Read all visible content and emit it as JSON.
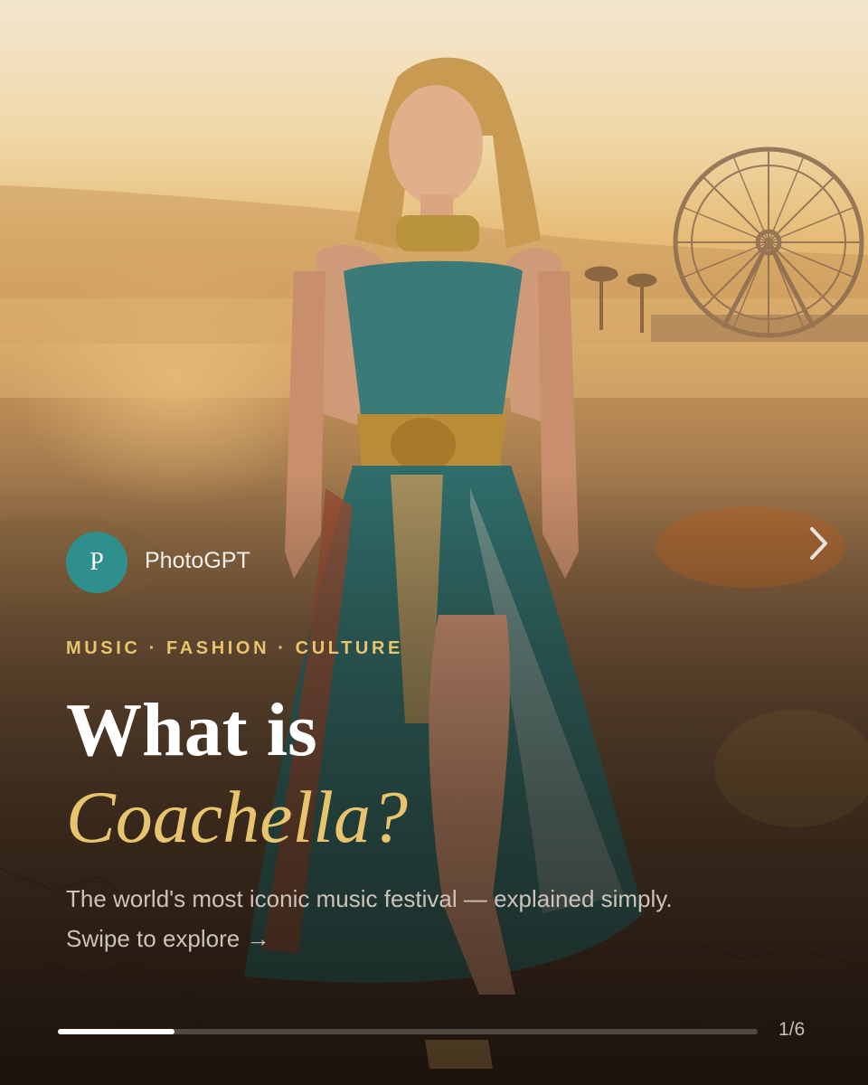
{
  "post": {
    "author": {
      "name": "PhotoGPT",
      "avatar_letter": "P",
      "avatar_color": "#2f8f8c"
    },
    "tags": "MUSIC · FASHION · CULTURE",
    "title_line1": "What is",
    "title_line2": "Coachella?",
    "subtitle": "The world's most iconic music festival — explained simply.",
    "cta": "Swipe to explore →",
    "progress": {
      "current": 1,
      "total": 6,
      "fraction": 0.167,
      "label": "1/6"
    },
    "next_icon": "chevron-right-icon",
    "photo": "woman-in-festival-dress-desert-ferris-wheel-image"
  },
  "colors": {
    "accent": "#e8c46e",
    "text": "#ffffff",
    "muted": "#cbc3b9"
  }
}
